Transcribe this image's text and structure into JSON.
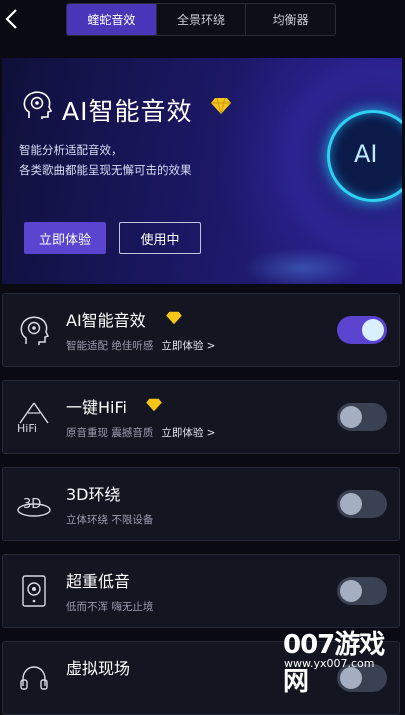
{
  "tabs": [
    {
      "label": "蝰蛇音效",
      "active": true
    },
    {
      "label": "全景环绕",
      "active": false
    },
    {
      "label": "均衡器",
      "active": false
    }
  ],
  "hero": {
    "title": "AI智能音效",
    "desc_line1": "智能分析适配音效，",
    "desc_line2": "各类歌曲都能呈现无懈可击的效果",
    "try_label": "立即体验",
    "using_label": "使用中",
    "disc_label": "AI"
  },
  "cards": [
    {
      "title": "AI智能音效",
      "sub": "智能适配 绝佳听感",
      "link": "立即体验 >",
      "gem": true,
      "on": true,
      "icon": "ai-head-icon"
    },
    {
      "title": "一键HiFi",
      "sub": "原音重现 震撼音质",
      "link": "立即体验 >",
      "gem": true,
      "on": false,
      "icon": "hifi-icon"
    },
    {
      "title": "3D环绕",
      "sub": "立体环绕 不限设备",
      "link": "",
      "gem": false,
      "on": false,
      "icon": "3d-icon"
    },
    {
      "title": "超重低音",
      "sub": "低而不浑 嗨无止境",
      "link": "",
      "gem": false,
      "on": false,
      "icon": "speaker-icon"
    },
    {
      "title": "虚拟现场",
      "sub": "",
      "link": "",
      "gem": false,
      "on": false,
      "icon": "headphones-icon"
    }
  ],
  "watermark": {
    "brand": "007游戏网",
    "url": "www.yx007.com"
  },
  "colors": {
    "accent": "#5a44d0",
    "gem": "#f5c518",
    "disc_glow": "#2fd0f0"
  }
}
